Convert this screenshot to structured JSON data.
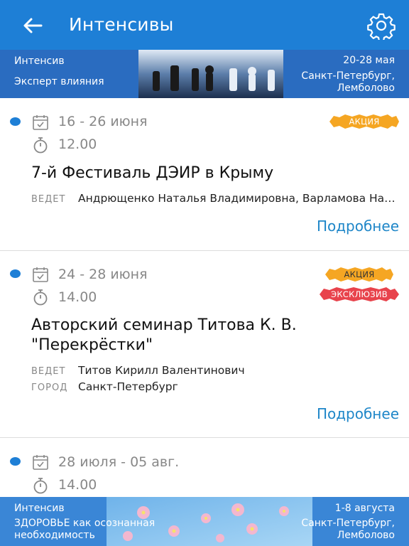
{
  "appbar": {
    "title": "Интенсивы",
    "back_icon": "arrow-left-icon",
    "settings_icon": "gear-icon"
  },
  "banner_top": {
    "kind": "Интенсив",
    "name": "Эксперт влияния",
    "dates": "20-28 мая",
    "place_line1": "Санкт-Петербург,",
    "place_line2": "Лемболово"
  },
  "events": [
    {
      "dates": "16 - 26 июня",
      "time": "12.00",
      "title": "7-й Фестиваль ДЭИР в Крыму",
      "host_label": "ВЕДЕТ",
      "host": "Андрющенко Наталья Владимировна, Варламова Наталья",
      "badges": [
        "АКЦИЯ"
      ],
      "more": "Подробнее"
    },
    {
      "dates": "24 - 28 июня",
      "time": "14.00",
      "title_line1": "Авторский семинар Титова К. В.",
      "title_line2": "\"Перекрёстки\"",
      "host_label": "ВЕДЕТ",
      "host": "Титов Кирилл Валентинович",
      "city_label": "ГОРОД",
      "city": "Санкт-Петербург",
      "badges": [
        "АКЦИЯ",
        "ЭКСКЛЮЗИВ"
      ],
      "more": "Подробнее"
    },
    {
      "dates": "28 июля - 05 авг.",
      "time": "14.00"
    }
  ],
  "banner_bottom": {
    "kind": "Интенсив",
    "name_line1": "ЗДОРОВЬЕ как осознанная",
    "name_line2": "необходимость",
    "dates": "1-8 августа",
    "place_line1": "Санкт-Петербург,",
    "place_line2": "Лемболово"
  },
  "colors": {
    "primary": "#1e7fd6",
    "link": "#1e86c8",
    "promo": "#f5a623",
    "exclusive": "#e8434c"
  }
}
